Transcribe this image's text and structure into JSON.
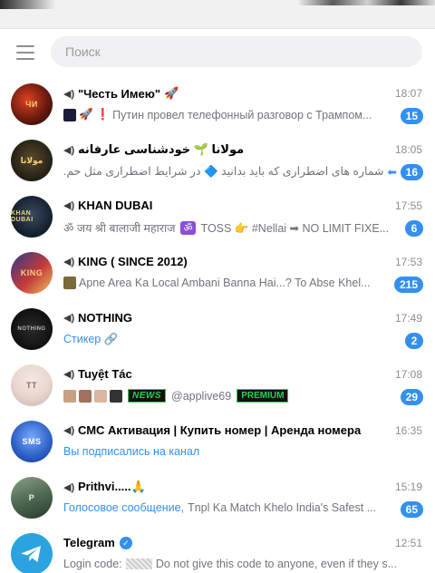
{
  "search": {
    "placeholder": "Поиск"
  },
  "chats": [
    {
      "title": "\"Честь Имею\"",
      "time": "18:07",
      "preview": "Путин провел телефонный разговор с Трампом...",
      "unread": "15",
      "avatar_text": "ЧИ",
      "avatar_color": "#6b1a10"
    },
    {
      "title": "مولانا 🌱 خودشناسی عارفانه",
      "time": "18:05",
      "preview": "شماره های اضطراری که باید بدانید 🔷 در شرایط اضطراری مثل حم...",
      "unread": "16",
      "avatar_text": "مولانا",
      "avatar_color": "#2a2418"
    },
    {
      "title": "KHAN DUBAI",
      "time": "17:55",
      "preview_prefix": "ॐ जय श्री बालाजी महाराज",
      "preview_text": "TOSS 👉 #Nellai ➡ NO LIMIT FIXE...",
      "unread": "6",
      "avatar_text": "KHAN DUBAI",
      "avatar_color": "#14202e"
    },
    {
      "title": "KING ( SINCE 2012)",
      "time": "17:53",
      "preview": "Apne Area Ka Local Ambani Banna Hai...? To Abse Khel...",
      "unread": "215",
      "avatar_text": "KING",
      "avatar_color": "#c23a3a"
    },
    {
      "title": "NOTHING",
      "time": "17:49",
      "preview": "Стикер 🔗",
      "unread": "2",
      "avatar_text": "NOTHING",
      "avatar_color": "#101010"
    },
    {
      "title": "Tuyệt Tác",
      "time": "17:08",
      "preview_news": "NEWS",
      "preview_handle": "@applive69",
      "preview_premium": "PREMIUM",
      "unread": "29",
      "avatar_text": "TT",
      "avatar_color": "#e8d8d0"
    },
    {
      "title": "СМС Активация | Купить номер | Аренда номера",
      "time": "16:35",
      "preview": "Вы подписались на канал",
      "avatar_text": "SMS",
      "avatar_color": "#2a5fc4"
    },
    {
      "title": "Prithvi.....🙏",
      "time": "15:19",
      "preview_accent": "Голосовое сообщение,",
      "preview_text": "Tnpl Ka Match Khelo India's Safest ...",
      "unread": "65",
      "avatar_text": "P",
      "avatar_color": "#4f6a52"
    },
    {
      "title": "Telegram",
      "time": "12:51",
      "preview_prefix": "Login code:",
      "preview_text": "Do not give this code to anyone, even if they s...",
      "avatar_color": "#2aa3e0"
    }
  ]
}
